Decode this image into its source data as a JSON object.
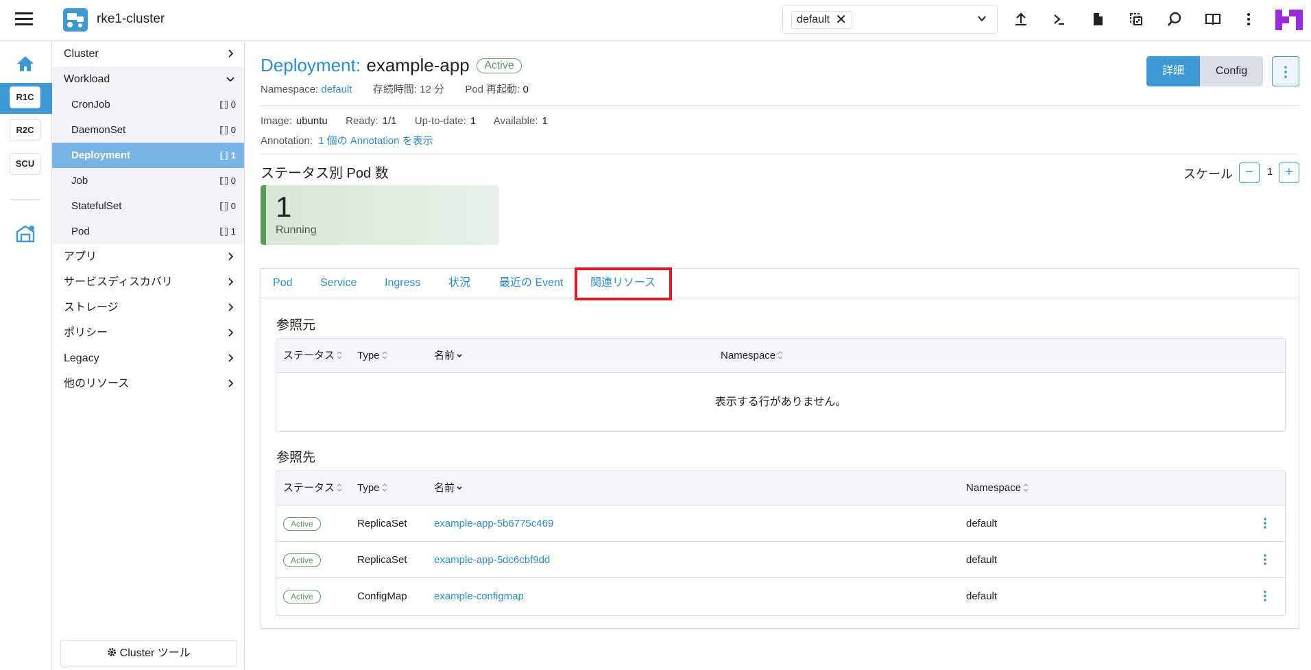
{
  "header": {
    "cluster_title": "rke1-cluster",
    "namespace_chip": "default",
    "namespace_chip_remove": "✕"
  },
  "rail": {
    "badges": [
      "R1C",
      "R2C",
      "SCU"
    ]
  },
  "sidenav": {
    "groups_top": [
      {
        "label": "Cluster"
      },
      {
        "label": "Workload"
      }
    ],
    "workload_items": [
      {
        "label": "CronJob",
        "count": "0"
      },
      {
        "label": "DaemonSet",
        "count": "0"
      },
      {
        "label": "Deployment",
        "count": "1"
      },
      {
        "label": "Job",
        "count": "0"
      },
      {
        "label": "StatefulSet",
        "count": "0"
      },
      {
        "label": "Pod",
        "count": "1"
      }
    ],
    "groups_bottom": [
      {
        "label": "アプリ"
      },
      {
        "label": "サービスディスカバリ"
      },
      {
        "label": "ストレージ"
      },
      {
        "label": "ポリシー"
      },
      {
        "label": "Legacy"
      },
      {
        "label": "他のリソース"
      }
    ],
    "cluster_tools": "Cluster ツール",
    "count_icon": "⟦⟧"
  },
  "page": {
    "kind": "Deployment:",
    "name": "example-app",
    "state": "Active",
    "namespace_label": "Namespace:",
    "namespace_value": "default",
    "age_label": "存続時間:",
    "age_value": "12 分",
    "restarts_label": "Pod 再起動:",
    "restarts_value": "0",
    "btn_detail": "詳細",
    "btn_config": "Config",
    "image_label": "Image:",
    "image_value": "ubuntu",
    "ready_label": "Ready:",
    "ready_value": "1/1",
    "uptodate_label": "Up-to-date:",
    "uptodate_value": "1",
    "available_label": "Available:",
    "available_value": "1",
    "annotation_label": "Annotation:",
    "annotation_link": "1 個の Annotation を表示",
    "pods_by_status_title": "ステータス別 Pod 数",
    "scale_label": "スケール",
    "scale_value": "1",
    "scale_minus": "−",
    "scale_plus": "+",
    "pod_count": "1",
    "pod_status": "Running"
  },
  "tabs": [
    {
      "label": "Pod"
    },
    {
      "label": "Service"
    },
    {
      "label": "Ingress"
    },
    {
      "label": "状況"
    },
    {
      "label": "最近の Event"
    },
    {
      "label": "関連リソース"
    }
  ],
  "referred_by": {
    "title": "参照元",
    "columns": [
      "ステータス",
      "Type",
      "名前",
      "Namespace"
    ],
    "empty_message": "表示する行がありません。"
  },
  "refers_to": {
    "title": "参照先",
    "columns": [
      "ステータス",
      "Type",
      "名前",
      "Namespace"
    ],
    "rows": [
      {
        "status": "Active",
        "type": "ReplicaSet",
        "name": "example-app-5b6775c469",
        "namespace": "default"
      },
      {
        "status": "Active",
        "type": "ReplicaSet",
        "name": "example-app-5dc6cbf9dd",
        "namespace": "default"
      },
      {
        "status": "Active",
        "type": "ConfigMap",
        "name": "example-configmap",
        "namespace": "default"
      }
    ]
  },
  "colors": {
    "accent": "#3d98d3",
    "link": "#2a8ed0",
    "active_green": "#5d995d",
    "highlight_red": "#e01a22",
    "nav_active": "#76b3e7",
    "brand_purple": "#9b2bdc"
  }
}
